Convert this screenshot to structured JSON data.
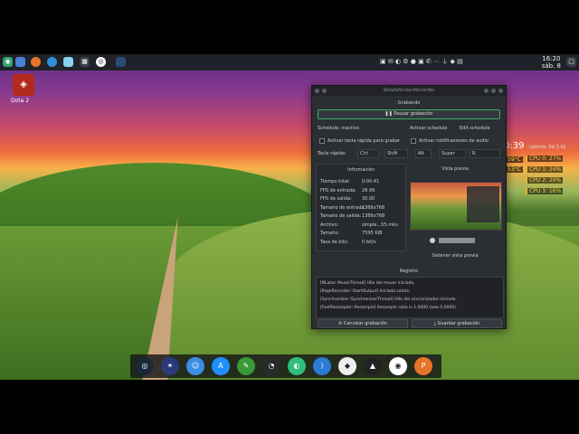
{
  "panel": {
    "clock_time": "16:20",
    "clock_date": "sáb. 8"
  },
  "desktop": {
    "icon_label": "Dota 2"
  },
  "conky": {
    "big_time": "0:39",
    "uptime": "Uptime: 0d 2:42",
    "temp1": "59°C",
    "temp2": "53°C",
    "cpus": [
      "CPU 0: 27%",
      "CPU 1: 24%",
      "CPU 2: 20%",
      "CPU 3: 16%"
    ]
  },
  "window": {
    "title": "SimpleScreenRecorder",
    "status_title": "Grabando",
    "pause_button": "Pausar grabación",
    "schedule_status": "Schedule: inactivo",
    "activate_schedule": "Activar schedule",
    "edit_schedule": "Edit schedule",
    "hotkey_check": "Activar tecla rápida para grabar",
    "notify_check": "Activar notificaciones de audio",
    "hotkey_label": "Tecla rápida:",
    "hotkey_ctrl": "Ctrl",
    "hotkey_shift": "Shift",
    "hotkey_alt": "Alt",
    "hotkey_super": "Super",
    "hotkey_key": "R",
    "info_title": "Información",
    "info_rows": [
      {
        "k": "Tiempo total:",
        "v": "0:00:41"
      },
      {
        "k": "FPS de entrada:",
        "v": "29.99"
      },
      {
        "k": "FPS de salida:",
        "v": "30.00"
      },
      {
        "k": "Tamaño de entrada:",
        "v": "1366x768"
      },
      {
        "k": "Tamaño de salida:",
        "v": "1366x768"
      },
      {
        "k": "Archivo:",
        "v": "simple...55.mkv"
      },
      {
        "k": "Tamaño:",
        "v": "7595 KiB"
      },
      {
        "k": "Tasa de bits:",
        "v": "0 bit/s"
      }
    ],
    "preview_title": "Vista previa",
    "stop_preview": "Detener vista previa",
    "log_title": "Registro",
    "log_lines": [
      "[NLatec MuxerThread] Hilo del muxer iniciado.",
      "[PageRecorder::StartOutput] Iniciada salida.",
      "[Synchronizer::SynchronizerThread] Hilo del sincronizador iniciado.",
      "[FastResampler::Resample] Resample ratio is 1.0000 (was 0.0000)."
    ],
    "cancel_button": "Cancelar grabación",
    "save_button": "Guardar grabación"
  },
  "dock": {
    "icons": [
      "steam-icon",
      "krita-icon",
      "finder-icon",
      "appstore-icon",
      "pycharm-icon",
      "vlc-icon",
      "clementine-icon",
      "vscode-icon",
      "unity-icon",
      "inkscape-icon",
      "blender-icon",
      "wps-icon"
    ]
  }
}
